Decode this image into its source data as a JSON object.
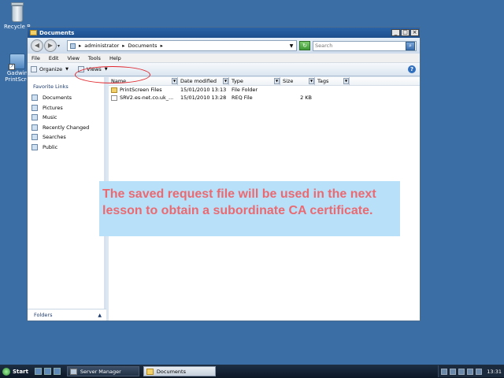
{
  "desktop": {
    "recycle_label": "Recycle B",
    "app_label_1": "Gadwin",
    "app_label_2": "PrintScre"
  },
  "window": {
    "title": "Documents"
  },
  "address": {
    "crumbs": [
      "administrator",
      "Documents"
    ],
    "sep": "▸",
    "search_placeholder": "Search"
  },
  "menu": [
    "File",
    "Edit",
    "View",
    "Tools",
    "Help"
  ],
  "toolbar": {
    "organize": "Organize",
    "views": "Views"
  },
  "nav": {
    "heading": "Favorite Links",
    "items": [
      "Documents",
      "Pictures",
      "Music",
      "Recently Changed",
      "Searches",
      "Public"
    ],
    "folders": "Folders"
  },
  "columns": [
    "Name",
    "Date modified",
    "Type",
    "Size",
    "Tags"
  ],
  "files": [
    {
      "name": "PrintScreen Files",
      "date": "15/01/2010 13:13",
      "type": "File Folder",
      "size": ""
    },
    {
      "name": "SRV2.es-net.co.uk_...",
      "date": "15/01/2010 13:28",
      "type": "REQ File",
      "size": "2 KB"
    }
  ],
  "callout": "The saved request file will be used in the next lesson to obtain a subordinate CA certificate.",
  "taskbar": {
    "start": "Start",
    "tasks": [
      "Server Manager",
      "Documents"
    ],
    "clock": "13:31"
  }
}
